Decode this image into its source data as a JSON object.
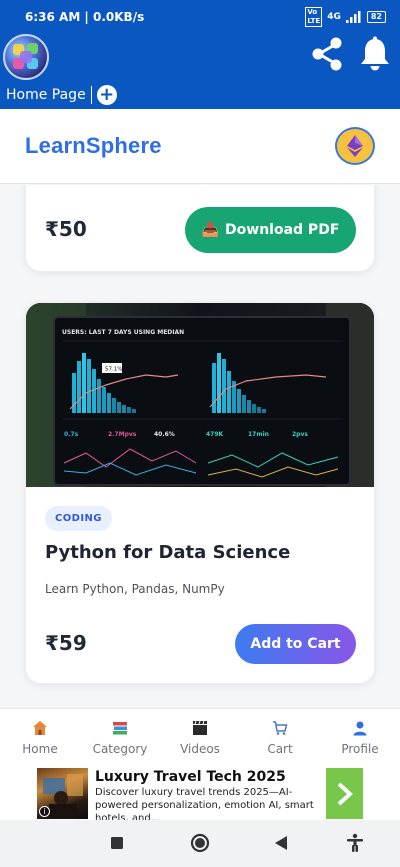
{
  "status_bar": {
    "time_speed": "6:36 AM | 0.0KB/s",
    "network": "4G",
    "battery": "82"
  },
  "app_header": {
    "tab_label": "Home Page",
    "add_tab": "+"
  },
  "page_header": {
    "brand": "LearnSphere"
  },
  "cards": {
    "top": {
      "price": "₹50",
      "button_icon": "📥",
      "button_label": "Download PDF"
    },
    "main": {
      "category": "CODING",
      "title": "Python for Data Science",
      "subtitle": "Learn Python, Pandas, NumPy",
      "price": "₹59",
      "button_label": "Add to Cart",
      "thumbnail": {
        "header": "USERS: LAST 7 DAYS USING MEDIAN",
        "callout": "57.1%",
        "metric_labels": [
          "0.7s",
          "2.7Mpvs",
          "40.6%",
          "479K",
          "17min",
          "2pvs"
        ]
      }
    }
  },
  "bottom_nav": {
    "items": [
      {
        "icon": "home-icon",
        "label": "Home"
      },
      {
        "icon": "category-icon",
        "label": "Category"
      },
      {
        "icon": "videos-icon",
        "label": "Videos"
      },
      {
        "icon": "cart-icon",
        "label": "Cart"
      },
      {
        "icon": "profile-icon",
        "label": "Profile"
      }
    ]
  },
  "ad": {
    "title": "Luxury Travel Tech 2025",
    "description": "Discover luxury travel trends 2025—AI-powered personalization, emotion AI, smart hotels, and...",
    "info": "i"
  },
  "colors": {
    "header_blue": "#0a57c2",
    "brand_blue": "#2f6fe6",
    "download_green": "#17a673",
    "cart_gradient_start": "#3b7cf0",
    "cart_gradient_end": "#8a56e8",
    "ad_arrow_green": "#78c74a"
  }
}
